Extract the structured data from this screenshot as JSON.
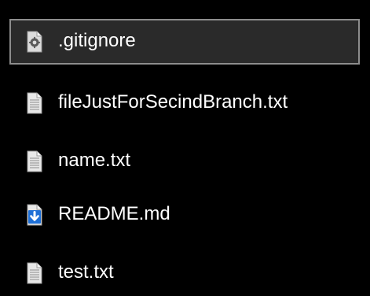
{
  "file_list": {
    "items": [
      {
        "label": ".gitignore",
        "icon": "gear-file-icon",
        "selected": true
      },
      {
        "label": "fileJustForSecindBranch.txt",
        "icon": "text-file-icon",
        "selected": false
      },
      {
        "label": "name.txt",
        "icon": "text-file-icon",
        "selected": false
      },
      {
        "label": "README.md",
        "icon": "markdown-download-file-icon",
        "selected": false
      },
      {
        "label": "test.txt",
        "icon": "text-file-icon",
        "selected": false
      }
    ]
  },
  "colors": {
    "background": "#000000",
    "text": "#ffffff",
    "selection_border": "#8d8d8d",
    "selection_fill": "#2a2a2a",
    "icon_file": "#e8e8e8",
    "icon_accent_blue": "#1e6fd6"
  }
}
